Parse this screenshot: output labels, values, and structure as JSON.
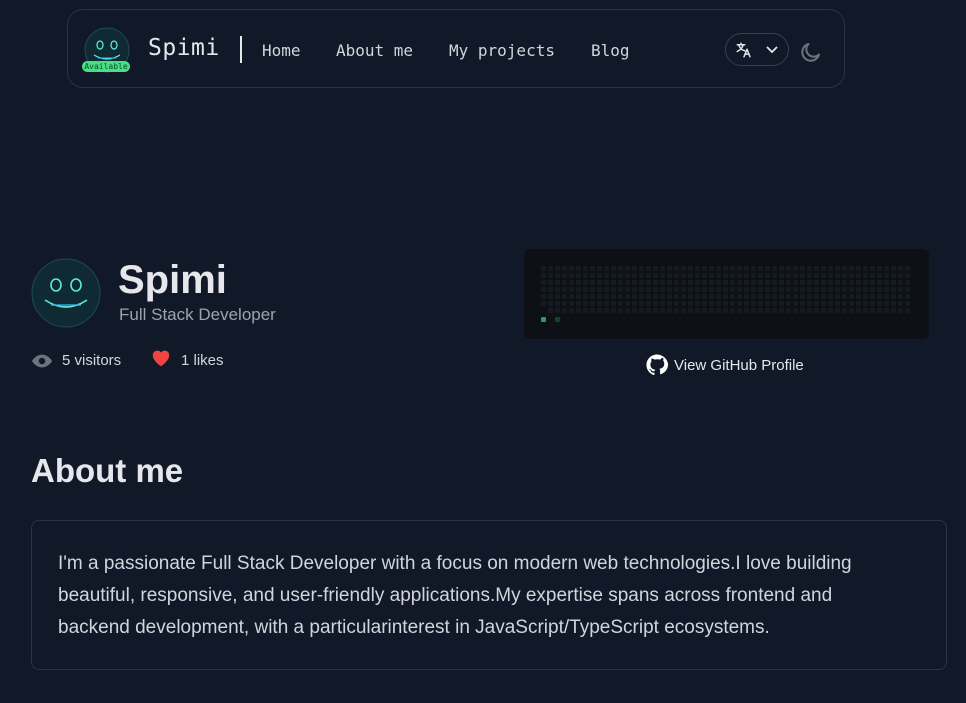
{
  "nav": {
    "brand": "Spimi",
    "badge": "Available",
    "links": [
      {
        "label": "Home"
      },
      {
        "label": "About me"
      },
      {
        "label": "My projects"
      },
      {
        "label": "Blog"
      }
    ],
    "language_icon": "translate-icon",
    "theme_icon": "moon-icon"
  },
  "profile": {
    "name": "Spimi",
    "role": "Full Stack Developer",
    "visitors": "5 visitors",
    "likes": "1 likes"
  },
  "github": {
    "link_label": "View GitHub Profile",
    "contribution_weeks": 53,
    "contribution_days": 7
  },
  "about": {
    "heading": "About me",
    "body": "I'm a passionate Full Stack Developer with a focus on modern web technologies.I love building beautiful, responsive, and user-friendly applications.My expertise spans across frontend and backend development, with a particularinterest in JavaScript/TypeScript ecosystems."
  },
  "colors": {
    "background": "#111827",
    "badge": "#4ade80",
    "heart": "#ef4444",
    "contribution_empty": "#161b22",
    "contribution_active": "#0e4429"
  }
}
